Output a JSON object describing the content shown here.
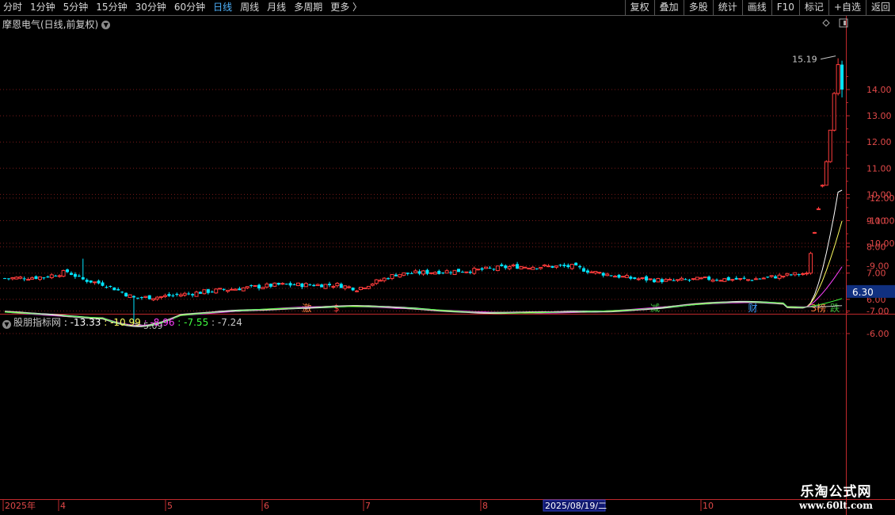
{
  "toolbar": {
    "periods": [
      "分时",
      "1分钟",
      "5分钟",
      "15分钟",
      "30分钟",
      "60分钟",
      "日线",
      "周线",
      "月线",
      "多周期",
      "更多 〉"
    ],
    "active_period": "日线",
    "right_buttons": [
      "复权",
      "叠加",
      "多股",
      "统计",
      "画线",
      "F10",
      "标记",
      "+自选",
      "返回"
    ]
  },
  "stock": {
    "title": "摩恩电气(日线,前复权)",
    "current_price": "6.30",
    "high_label": "15.19",
    "low_label": "5.09"
  },
  "markers": [
    {
      "text": "激",
      "color": "#ff8040",
      "idx": 77
    },
    {
      "text": "$",
      "color": "#ff4040",
      "idx": 85
    },
    {
      "text": "减",
      "color": "#40c040",
      "idx": 166
    },
    {
      "text": "财",
      "color": "#40a0ff",
      "idx": 191
    },
    {
      "text": "3榜",
      "color": "#ff8040",
      "idx": 207
    },
    {
      "text": "跌",
      "color": "#40c040",
      "idx": 212
    }
  ],
  "indicator": {
    "name": "股朋指标网",
    "values": [
      {
        "text": ": -13.33",
        "color": "#ffffff"
      },
      {
        "text": ": -10.99",
        "color": "#ffff60"
      },
      {
        "text": ": -8.96",
        "color": "#ff40ff"
      },
      {
        "text": ": -7.55",
        "color": "#40ff40"
      },
      {
        "text": ": -7.24",
        "color": "#c8c8c8"
      }
    ]
  },
  "price_axis": {
    "ticks": [
      "14.00",
      "13.00",
      "12.00",
      "11.00",
      "10.00",
      "9.00",
      "8.00",
      "7.00",
      "6.00"
    ]
  },
  "indicator_axis": {
    "ticks": [
      "-6.00",
      "-7.00",
      "-8.00",
      "-9.00",
      "-10.00",
      "-11.00",
      "-12.00"
    ]
  },
  "x_axis": {
    "labels": [
      "2025年",
      "4",
      "5",
      "6",
      "7",
      "8",
      "9",
      "10"
    ],
    "cursor_date": "2025/08/19/二"
  },
  "colors": {
    "up": "#ff3c3c",
    "down": "#00e5ff",
    "axis": "#c0282c",
    "grid": "#7a1a1a"
  },
  "watermark": {
    "line1": "乐淘公式网",
    "line2": "www.60lt.com"
  },
  "chart_data": {
    "type": "candlestick",
    "price_range": [
      5.0,
      15.2
    ],
    "indicator_range": [
      -12.3,
      -5.6
    ],
    "series": [
      {
        "name": "股朋指标网 1",
        "color": "#ffffff",
        "last": -13.33
      },
      {
        "name": "股朋指标网 2",
        "color": "#ffff60",
        "last": -10.99
      },
      {
        "name": "股朋指标网 3",
        "color": "#ff40ff",
        "last": -8.96
      },
      {
        "name": "股朋指标网 4",
        "color": "#40ff40",
        "last": -7.55
      },
      {
        "name": "股朋指标网 5",
        "color": "#c8c8c8",
        "last": -7.24
      }
    ]
  }
}
